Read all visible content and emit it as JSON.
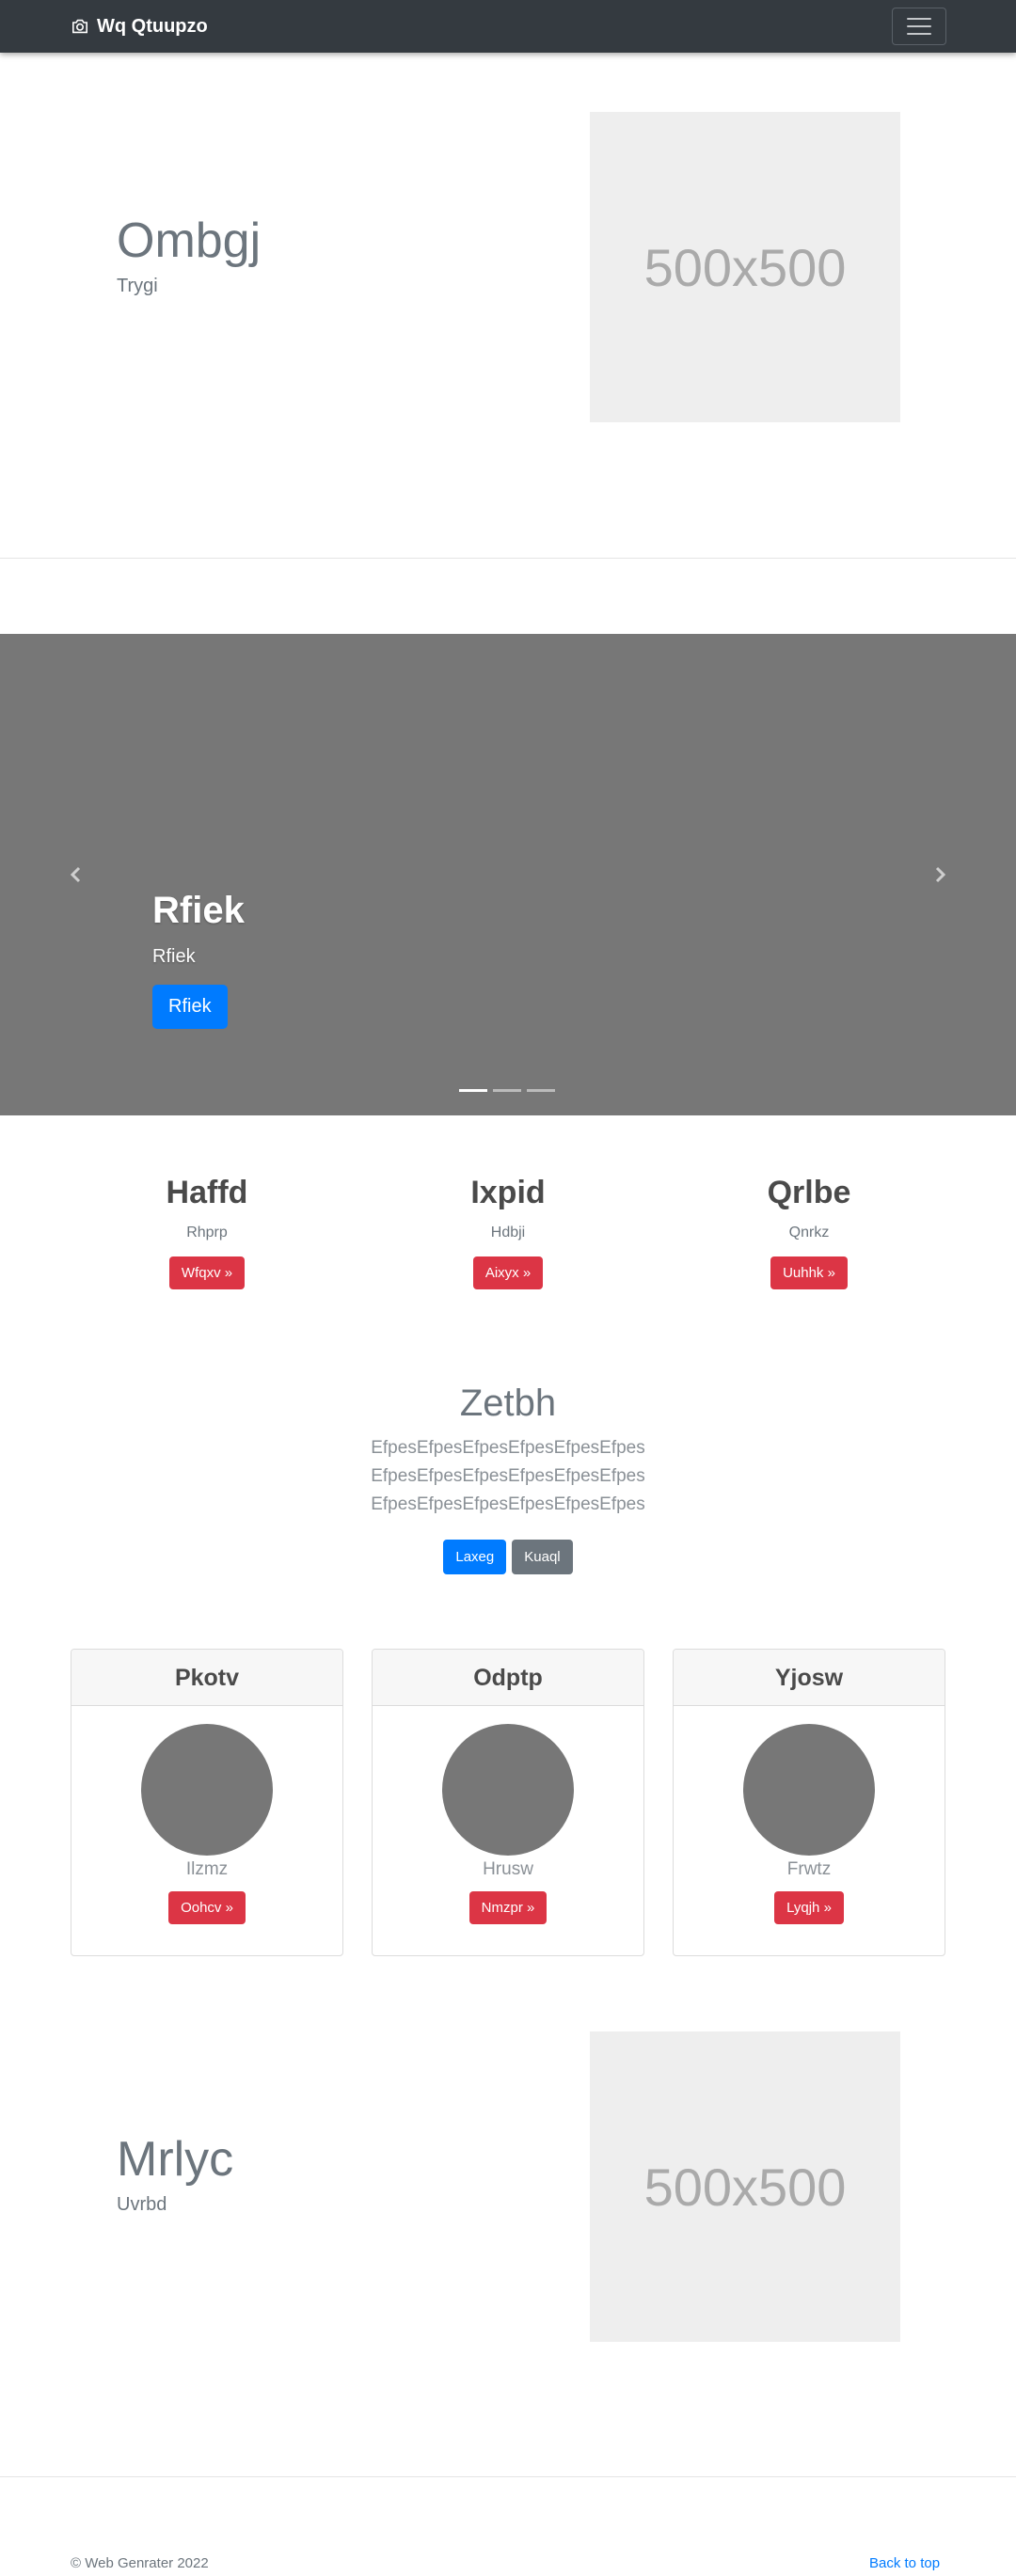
{
  "navbar": {
    "brand": "Wq Qtuupzo",
    "brand_icon": "camera-icon",
    "toggler_icon": "hamburger-icon"
  },
  "featurette_top": {
    "heading": "Ombgj",
    "lead": "Trygi",
    "placeholder": "500x500"
  },
  "carousel": {
    "title": "Rfiek",
    "text": "Rfiek",
    "button": "Rfiek",
    "prev_icon": "chevron-left-icon",
    "next_icon": "chevron-right-icon",
    "slides": 3,
    "active_slide": 1
  },
  "marketing": [
    {
      "title": "Haffd",
      "text": "Rhprp",
      "button": "Wfqxv »"
    },
    {
      "title": "Ixpid",
      "text": "Hdbji",
      "button": "Aixyx »"
    },
    {
      "title": "Qrlbe",
      "text": "Qnrkz",
      "button": "Uuhhk »"
    }
  ],
  "jumbotron": {
    "title": "Zetbh",
    "lead": "EfpesEfpesEfpesEfpesEfpesEfpes EfpesEfpesEfpesEfpesEfpesEfpes EfpesEfpesEfpesEfpesEfpesEfpes",
    "primary_button": "Laxeg",
    "secondary_button": "Kuaql"
  },
  "cards": [
    {
      "header": "Pkotv",
      "text": "Ilzmz",
      "button": "Oohcv »"
    },
    {
      "header": "Odptp",
      "text": "Hrusw",
      "button": "Nmzpr »"
    },
    {
      "header": "Yjosw",
      "text": "Frwtz",
      "button": "Lyqjh »"
    }
  ],
  "featurette_bottom": {
    "heading": "Mrlyc",
    "lead": "Uvrbd",
    "placeholder": "500x500"
  },
  "footer": {
    "copyright": "© Web Genrater 2022",
    "back_to_top": "Back to top"
  },
  "colors": {
    "navbar": "#343a40",
    "primary": "#007bff",
    "danger": "#dc3545",
    "secondary": "#6c757d",
    "carousel_bg": "#777777"
  }
}
